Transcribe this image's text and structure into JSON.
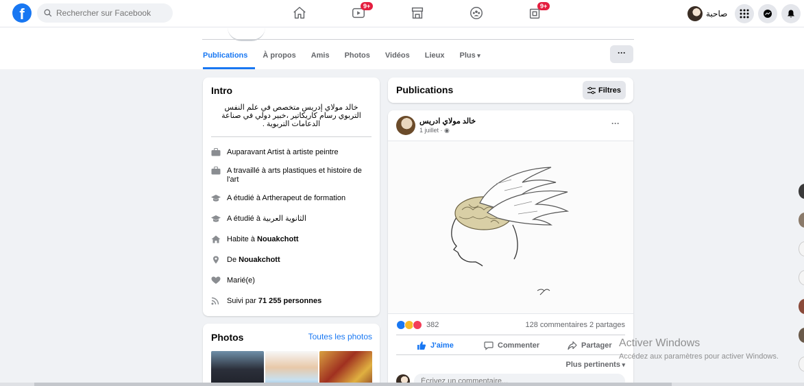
{
  "topbar": {
    "logo": "f",
    "search_placeholder": "Rechercher sur Facebook",
    "nav": [
      {
        "name": "home",
        "icon": "home-icon",
        "badge": ""
      },
      {
        "name": "watch",
        "icon": "video-icon",
        "badge": "9+"
      },
      {
        "name": "marketplace",
        "icon": "store-icon",
        "badge": ""
      },
      {
        "name": "groups",
        "icon": "groups-icon",
        "badge": ""
      },
      {
        "name": "gaming",
        "icon": "gaming-icon",
        "badge": "9+"
      }
    ],
    "profile_name": "صاحبة",
    "buttons": [
      "menu-grid-icon",
      "messenger-icon",
      "notifications-icon"
    ]
  },
  "profile_tabs": {
    "items": [
      "Publications",
      "À propos",
      "Amis",
      "Photos",
      "Vidéos",
      "Lieux",
      "Plus"
    ],
    "active": "Publications",
    "more_dots": "···"
  },
  "intro": {
    "title": "Intro",
    "bio": "خالد مولاي إدريس متخصص في علم النفس التربوي رسام كاريكاتير ،خبير دولي في صناعة الدعامات التربوية .",
    "items": [
      {
        "icon": "briefcase-icon",
        "text": "Auparavant Artist à artiste peintre",
        "bold": ""
      },
      {
        "icon": "briefcase-icon",
        "text": "A travaillé à arts plastiques et histoire de l'art",
        "bold": ""
      },
      {
        "icon": "graduation-cap-icon",
        "text": "A étudié à Artherapeut de formation",
        "bold": ""
      },
      {
        "icon": "graduation-cap-icon",
        "text": "A étudié à الثانوية العربية",
        "bold": ""
      },
      {
        "icon": "house-icon",
        "text": "Habite à ",
        "bold": "Nouakchott"
      },
      {
        "icon": "location-pin-icon",
        "text": "De ",
        "bold": "Nouakchott"
      },
      {
        "icon": "heart-icon",
        "text": "Marié(e)",
        "bold": ""
      },
      {
        "icon": "rss-icon",
        "text": "Suivi par ",
        "bold": "71 255 personnes"
      }
    ]
  },
  "photos": {
    "title": "Photos",
    "link": "Toutes les photos"
  },
  "publications": {
    "title": "Publications",
    "filters_label": "Filtres"
  },
  "post": {
    "author": "خالد مولاي ادريس",
    "date": "1 juillet · ",
    "more": "···",
    "reactions_count": "382",
    "comments": "128 commentaires",
    "shares": "2 partages",
    "like_label": "J'aime",
    "comment_label": "Commenter",
    "share_label": "Partager",
    "relevance": "Plus pertinents",
    "comment_placeholder": "Écrivez un commentaire..."
  },
  "watermark": {
    "title": "Activer Windows",
    "subtitle": "Accédez aux paramètres pour activer Windows."
  },
  "colors": {
    "brand": "#1877f2",
    "badge": "#e41e3f",
    "background": "#f0f2f5"
  }
}
